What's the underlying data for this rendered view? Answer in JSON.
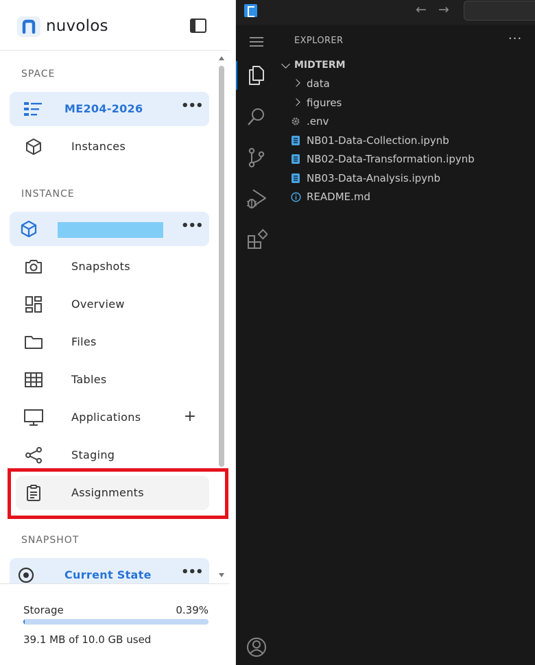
{
  "nuvolos": {
    "brand": "nuvolos",
    "sections": {
      "space": "SPACE",
      "instance": "INSTANCE",
      "snapshot": "SNAPSHOT"
    },
    "space_item": {
      "label": "ME204-2026",
      "more": "•••"
    },
    "instances_item": {
      "label": "Instances"
    },
    "instance_item": {
      "label": "",
      "more": "•••",
      "name_redacted": true
    },
    "nav_items": [
      {
        "label": "Snapshots",
        "icon": "camera-icon"
      },
      {
        "label": "Overview",
        "icon": "dashboard-icon"
      },
      {
        "label": "Files",
        "icon": "folder-icon"
      },
      {
        "label": "Tables",
        "icon": "table-icon"
      },
      {
        "label": "Applications",
        "icon": "monitor-icon",
        "action": "+"
      },
      {
        "label": "Staging",
        "icon": "share-icon"
      },
      {
        "label": "Assignments",
        "icon": "clipboard-icon",
        "highlighted": true
      }
    ],
    "snapshot_item": {
      "label": "Current State",
      "more": "•••"
    },
    "storage": {
      "label": "Storage",
      "percent_text": "0.39%",
      "percent_value": 0.39,
      "used_text": "39.1 MB of 10.0 GB used"
    },
    "colors": {
      "accent": "#2774d8",
      "active_bg": "#e5effc",
      "highlight_border": "#e4131c",
      "redaction": "#80cdf7"
    }
  },
  "vscode": {
    "nav": {
      "back": "←",
      "forward": "→"
    },
    "explorer": {
      "title": "EXPLORER",
      "more": "···",
      "folder": "MIDTERM",
      "entries": [
        {
          "name": "data",
          "type": "folder"
        },
        {
          "name": "figures",
          "type": "folder"
        },
        {
          "name": ".env",
          "type": "settings-file"
        },
        {
          "name": "NB01-Data-Collection.ipynb",
          "type": "notebook"
        },
        {
          "name": "NB02-Data-Transformation.ipynb",
          "type": "notebook"
        },
        {
          "name": "NB03-Data-Analysis.ipynb",
          "type": "notebook"
        },
        {
          "name": "README.md",
          "type": "info-file"
        }
      ]
    },
    "activity_icons": [
      "hamburger-menu-icon",
      "files-icon",
      "search-icon",
      "source-control-icon",
      "run-debug-icon",
      "extensions-icon",
      "account-icon"
    ],
    "colors": {
      "background": "#181818",
      "active_indicator": "#0078d4",
      "text": "#cccccc"
    }
  }
}
